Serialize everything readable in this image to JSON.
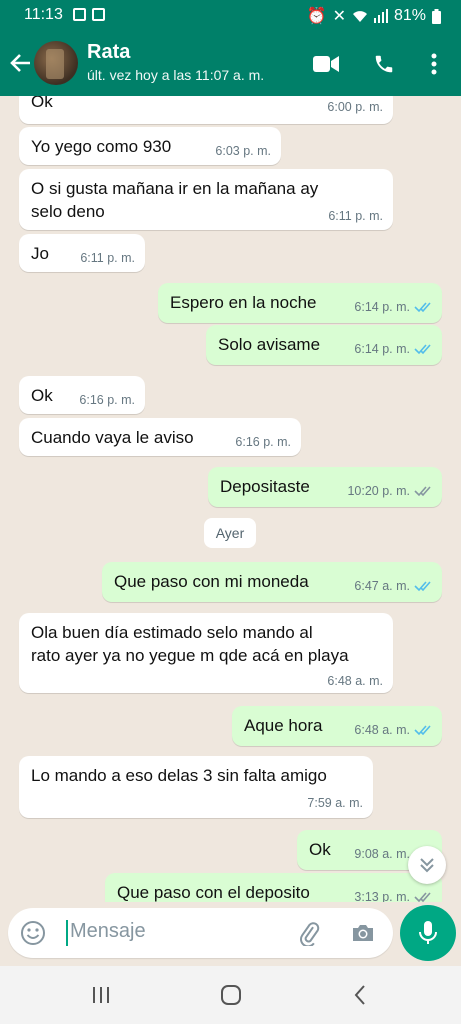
{
  "status": {
    "time": "11:13",
    "battery": "81%"
  },
  "header": {
    "name": "Rata",
    "status": "últ. vez hoy a las 11:07 a. m."
  },
  "messages": [
    {
      "text": "Ok",
      "time": "6:00 p. m."
    },
    {
      "text": "Yo yego como 930",
      "time": "6:03 p. m."
    },
    {
      "text": "O si gusta mañana ir en la mañana ay",
      "text2": "selo deno",
      "time": "6:11 p. m."
    },
    {
      "text": "Jo",
      "time": "6:11 p. m."
    },
    {
      "text": "Espero en la noche",
      "time": "6:14 p. m."
    },
    {
      "text": "Solo avisame",
      "time": "6:14 p. m."
    },
    {
      "text": "Ok",
      "time": "6:16 p. m."
    },
    {
      "text": "Cuando vaya le aviso",
      "time": "6:16 p. m."
    },
    {
      "text": "Depositaste",
      "time": "10:20 p. m."
    },
    {
      "text": "Que paso con mi moneda",
      "time": "6:47 a. m."
    },
    {
      "text": "Ola buen día estimado selo mando al",
      "text2": "rato ayer ya no yegue m qde acá en playa",
      "time": "6:48 a. m."
    },
    {
      "text": "Aque hora",
      "time": "6:48 a. m."
    },
    {
      "text": "Lo mando a eso delas 3 sin falta amigo",
      "time": "7:59 a. m."
    },
    {
      "text": "Ok",
      "time": "9:08 a. m."
    },
    {
      "text": "Que paso con el deposito",
      "time": "3:13 p. m."
    }
  ],
  "day_separator": "Ayer",
  "input": {
    "placeholder": "Mensaje"
  },
  "colors": {
    "header": "#008069",
    "outgoing": "#d9fdd3",
    "read_tick": "#53bdeb",
    "accent": "#00a884"
  }
}
